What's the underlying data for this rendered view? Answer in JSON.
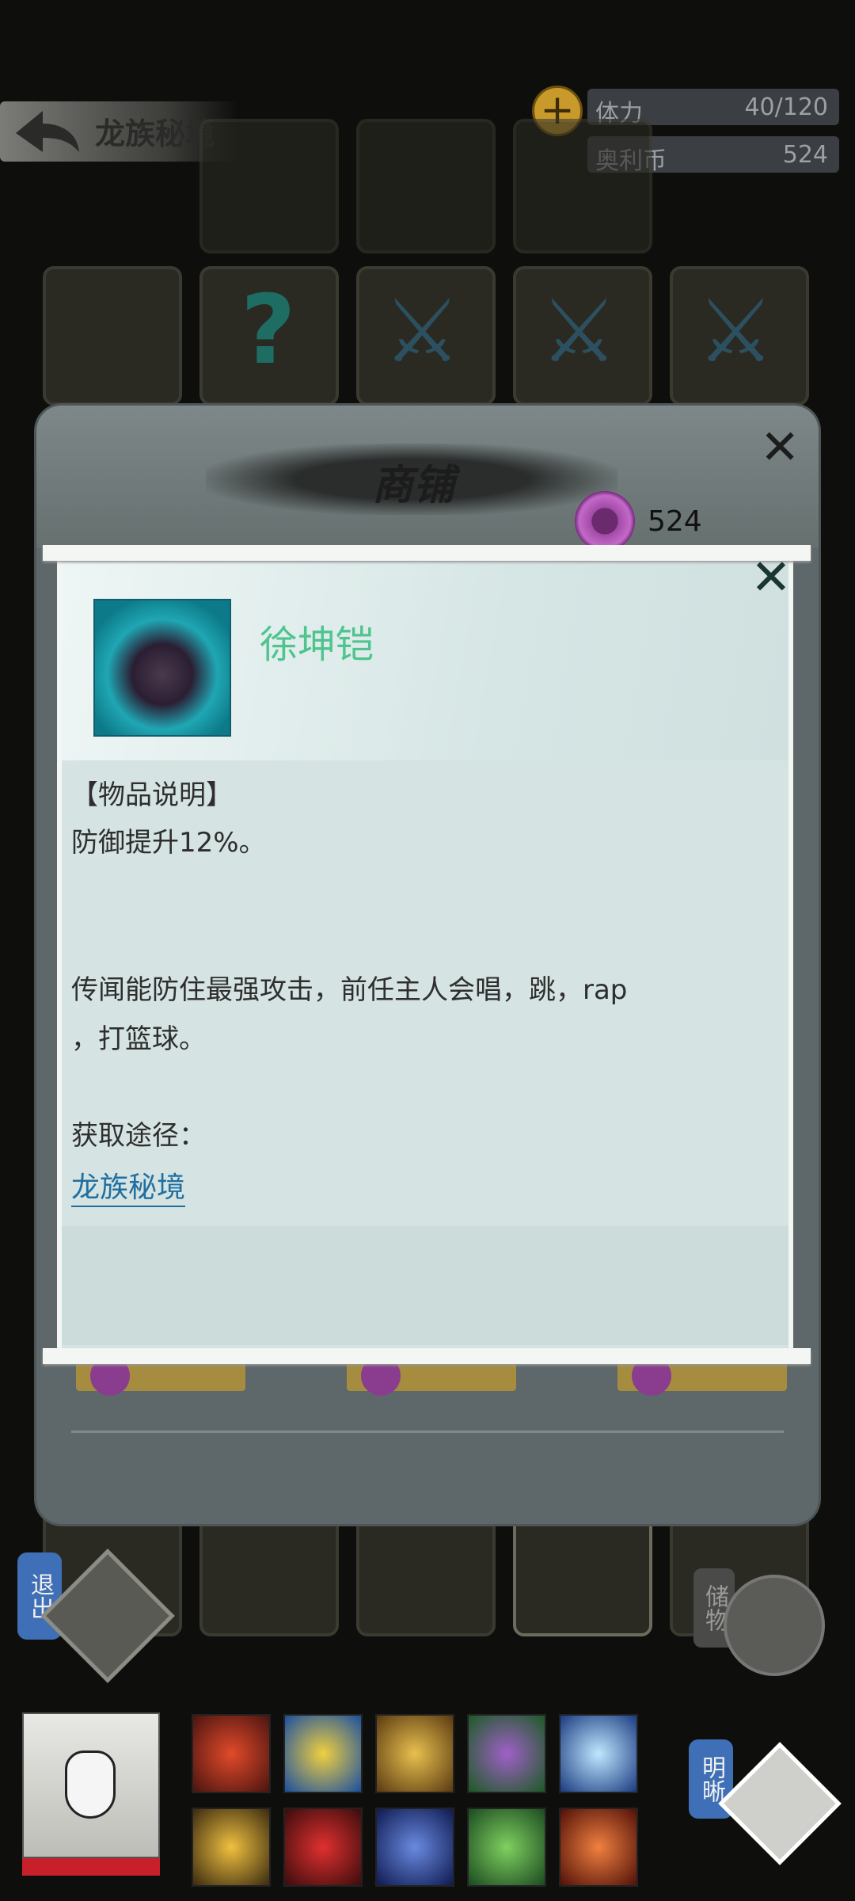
{
  "header": {
    "title": "龙族秘境",
    "stamina_label": "体力",
    "stamina_value": "40/120",
    "coin_label": "奥利币",
    "coin_value": "524"
  },
  "shop": {
    "title": "商铺",
    "balance": "524"
  },
  "item": {
    "name": "徐坤铠",
    "section_label": "【物品说明】",
    "effect": "防御提升12%。",
    "lore_line1": "传闻能防住最强攻击，前任主人会唱，跳，rap",
    "lore_line2": "，打篮球。",
    "source_label": "获取途径：",
    "source_link": "龙族秘境"
  },
  "bottom": {
    "exit_label": "退出",
    "storage_label": "储物",
    "insight_label": "明晰"
  },
  "colors": {
    "item_name": "#4fc48e",
    "link": "#1f6fa0",
    "hp_bar": "#c8202a"
  }
}
